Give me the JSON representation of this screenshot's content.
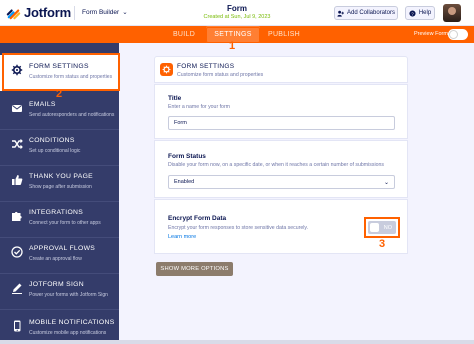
{
  "header": {
    "logo_text": "Jotform",
    "builder_dropdown": "Form Builder",
    "form_title": "Form",
    "form_subtitle": "Created at Sun, Jul 9, 2023",
    "add_collaborators": "Add Collaborators",
    "help": "Help"
  },
  "nav": {
    "tabs": [
      {
        "label": "BUILD"
      },
      {
        "label": "SETTINGS"
      },
      {
        "label": "PUBLISH"
      }
    ],
    "preview_label": "Preview Form",
    "accent": "#ff6100"
  },
  "sidebar": {
    "items": [
      {
        "title": "FORM SETTINGS",
        "desc": "Customize form status and properties",
        "icon": "gear-icon"
      },
      {
        "title": "EMAILS",
        "desc": "Send autoresponders and notifications",
        "icon": "envelope-icon"
      },
      {
        "title": "CONDITIONS",
        "desc": "Set up conditional logic",
        "icon": "shuffle-icon"
      },
      {
        "title": "THANK YOU PAGE",
        "desc": "Show page after submission",
        "icon": "thumbs-up-icon"
      },
      {
        "title": "INTEGRATIONS",
        "desc": "Connect your form to other apps",
        "icon": "puzzle-icon"
      },
      {
        "title": "APPROVAL FLOWS",
        "desc": "Create an approval flow",
        "icon": "approval-icon"
      },
      {
        "title": "JOTFORM SIGN",
        "desc": "Power your forms with Jotform Sign",
        "icon": "pen-icon"
      },
      {
        "title": "MOBILE NOTIFICATIONS",
        "desc": "Customize mobile app notifications",
        "icon": "mobile-icon"
      }
    ]
  },
  "main": {
    "header_title": "FORM SETTINGS",
    "header_desc": "Customize form status and properties",
    "title_label": "Title",
    "title_desc": "Enter a name for your form",
    "title_value": "Form",
    "status_label": "Form Status",
    "status_desc": "Disable your form now, on a specific date, or when it reaches a certain number of submissions",
    "status_value": "Enabled",
    "encrypt_label": "Encrypt Form Data",
    "encrypt_desc": "Encrypt your form responses to store sensitive data securely.",
    "learn_more": "Learn more",
    "encrypt_toggle": "NO",
    "show_more": "SHOW MORE OPTIONS"
  },
  "annotations": {
    "one": "1",
    "two": "2",
    "three": "3"
  }
}
